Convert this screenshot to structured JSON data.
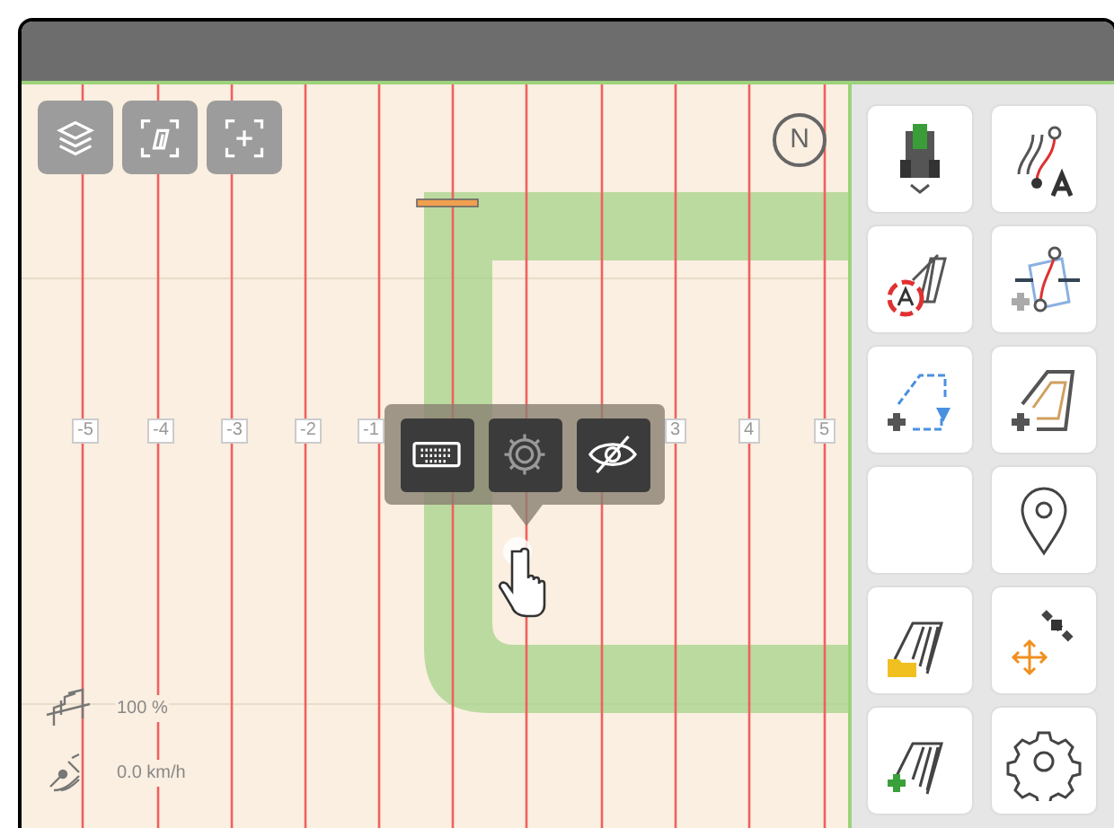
{
  "map": {
    "compass": "N",
    "lane_labels": [
      {
        "label": "-5"
      },
      {
        "label": "-4"
      },
      {
        "label": "-3"
      },
      {
        "label": "-2"
      },
      {
        "label": "-1"
      },
      {
        "label": "3"
      },
      {
        "label": "4"
      },
      {
        "label": "5"
      }
    ],
    "status": [
      {
        "kind": "workrate",
        "text": "100 %"
      },
      {
        "kind": "speed",
        "text": "0.0 km/h"
      }
    ],
    "map_tools": [
      {
        "kind": "layers"
      },
      {
        "kind": "field"
      },
      {
        "kind": "center"
      }
    ],
    "popup": [
      {
        "kind": "keyboard"
      },
      {
        "kind": "settings"
      },
      {
        "kind": "hide"
      }
    ]
  },
  "sidebar": {
    "buttons": [
      {
        "kind": "tractor"
      },
      {
        "kind": "track-a"
      },
      {
        "kind": "auto-field"
      },
      {
        "kind": "track-shift"
      },
      {
        "kind": "boundary-add"
      },
      {
        "kind": "headland-add"
      },
      {
        "kind": "empty"
      },
      {
        "kind": "marker"
      },
      {
        "kind": "field-open"
      },
      {
        "kind": "gps-shift"
      },
      {
        "kind": "field-new"
      },
      {
        "kind": "settings"
      }
    ]
  }
}
